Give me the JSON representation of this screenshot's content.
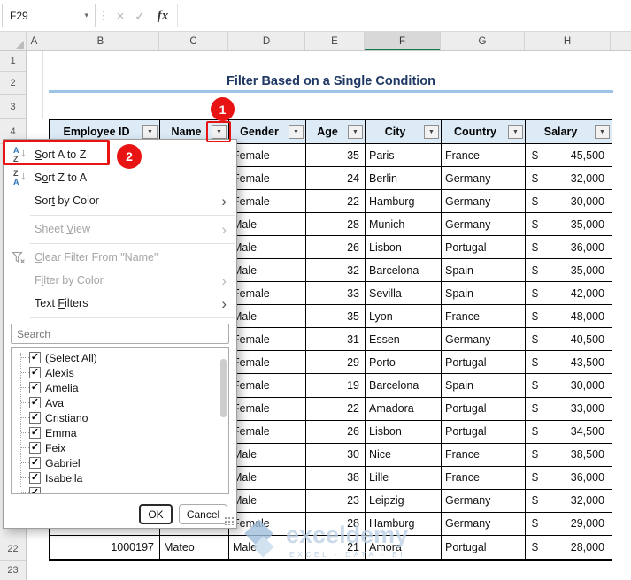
{
  "toolbar": {
    "name_box": "F29",
    "fx": "fx",
    "formula_value": ""
  },
  "sheet": {
    "column_letters": [
      "A",
      "B",
      "C",
      "D",
      "E",
      "F",
      "G",
      "H"
    ],
    "selected_column": "F",
    "row_numbers_top": [
      "1",
      "2",
      "3",
      "4"
    ],
    "row_numbers_bottom": [
      "22",
      "23"
    ],
    "title": "Filter Based on a Single Condition"
  },
  "table": {
    "headers": [
      "Employee ID",
      "Name",
      "Gender",
      "Age",
      "City",
      "Country",
      "Salary"
    ],
    "currency_symbol": "$",
    "rows": [
      {
        "employee_id": "",
        "name": "",
        "gender": "Female",
        "age": "35",
        "city": "Paris",
        "country": "France",
        "salary": "45,500"
      },
      {
        "employee_id": "",
        "name": "",
        "gender": "Female",
        "age": "24",
        "city": "Berlin",
        "country": "Germany",
        "salary": "32,000"
      },
      {
        "employee_id": "",
        "name": "",
        "gender": "Female",
        "age": "22",
        "city": "Hamburg",
        "country": "Germany",
        "salary": "30,000"
      },
      {
        "employee_id": "",
        "name": "",
        "gender": "Male",
        "age": "28",
        "city": "Munich",
        "country": "Germany",
        "salary": "35,000"
      },
      {
        "employee_id": "",
        "name": "",
        "gender": "Male",
        "age": "26",
        "city": "Lisbon",
        "country": "Portugal",
        "salary": "36,000"
      },
      {
        "employee_id": "",
        "name": "",
        "gender": "Male",
        "age": "32",
        "city": "Barcelona",
        "country": "Spain",
        "salary": "35,000"
      },
      {
        "employee_id": "",
        "name": "",
        "gender": "Female",
        "age": "33",
        "city": "Sevilla",
        "country": "Spain",
        "salary": "42,000"
      },
      {
        "employee_id": "",
        "name": "",
        "gender": "Male",
        "age": "35",
        "city": "Lyon",
        "country": "France",
        "salary": "48,000"
      },
      {
        "employee_id": "",
        "name": "",
        "gender": "Female",
        "age": "31",
        "city": "Essen",
        "country": "Germany",
        "salary": "40,500"
      },
      {
        "employee_id": "",
        "name": "",
        "gender": "Female",
        "age": "29",
        "city": "Porto",
        "country": "Portugal",
        "salary": "43,500"
      },
      {
        "employee_id": "",
        "name": "",
        "gender": "Female",
        "age": "19",
        "city": "Barcelona",
        "country": "Spain",
        "salary": "30,000"
      },
      {
        "employee_id": "",
        "name": "",
        "gender": "Female",
        "age": "22",
        "city": "Amadora",
        "country": "Portugal",
        "salary": "33,000"
      },
      {
        "employee_id": "",
        "name": "",
        "gender": "Female",
        "age": "26",
        "city": "Lisbon",
        "country": "Portugal",
        "salary": "34,500"
      },
      {
        "employee_id": "",
        "name": "",
        "gender": "Male",
        "age": "30",
        "city": "Nice",
        "country": "France",
        "salary": "38,500"
      },
      {
        "employee_id": "",
        "name": "",
        "gender": "Male",
        "age": "38",
        "city": "Lille",
        "country": "France",
        "salary": "36,000"
      },
      {
        "employee_id": "",
        "name": "",
        "gender": "Male",
        "age": "23",
        "city": "Leipzig",
        "country": "Germany",
        "salary": "32,000"
      },
      {
        "employee_id": "",
        "name": "",
        "gender": "Female",
        "age": "28",
        "city": "Hamburg",
        "country": "Germany",
        "salary": "29,000"
      },
      {
        "employee_id": "1000197",
        "name": "Mateo",
        "gender": "Male",
        "age": "21",
        "city": "Amora",
        "country": "Portugal",
        "salary": "28,000"
      }
    ]
  },
  "filter_menu": {
    "items": [
      {
        "pre": "",
        "key": "S",
        "post": "ort A to Z",
        "enabled": true,
        "submenu": false
      },
      {
        "pre": "S",
        "key": "o",
        "post": "rt Z to A",
        "enabled": true,
        "submenu": false
      },
      {
        "pre": "Sor",
        "key": "t",
        "post": " by Color",
        "enabled": true,
        "submenu": true
      },
      {
        "pre": "Sheet ",
        "key": "V",
        "post": "iew",
        "enabled": false,
        "submenu": true
      },
      {
        "pre": "",
        "key": "C",
        "post": "lear Filter From \"Name\"",
        "enabled": false,
        "submenu": false
      },
      {
        "pre": "F",
        "key": "i",
        "post": "lter by Color",
        "enabled": false,
        "submenu": true
      },
      {
        "pre": "Text ",
        "key": "F",
        "post": "ilters",
        "enabled": true,
        "submenu": true
      }
    ],
    "search_placeholder": "Search",
    "list_items": [
      "(Select All)",
      "Alexis",
      "Amelia",
      "Ava",
      "Cristiano",
      "Emma",
      "Feix",
      "Gabriel",
      "Isabella"
    ],
    "ok_label": "OK",
    "cancel_label": "Cancel"
  },
  "annotations": {
    "step_1": "1",
    "step_2": "2"
  },
  "watermark": {
    "brand": "exceldemy",
    "tagline": "EXCEL - DATA - BI"
  },
  "colors": {
    "header_fill": "#DDEBF7",
    "title_text": "#1F3864",
    "title_rule": "#9DC3E6",
    "annotation_red": "#E81414",
    "selected_column_green": "#107C41",
    "watermark_blue": "#AEC8DF"
  }
}
